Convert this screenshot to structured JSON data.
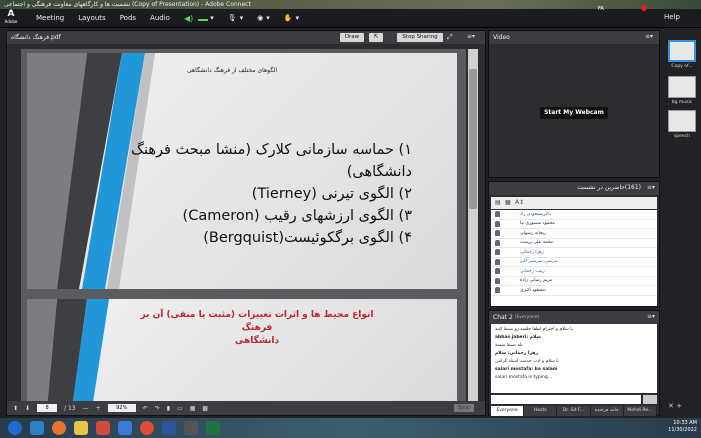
{
  "window": {
    "title": "نشست ها و کارگاههای معاونت فرهنگی و اجتماعی (Copy of Presentation) - Adobe Connect"
  },
  "menubar": {
    "logo": "Adobe",
    "items": [
      "Meeting",
      "Layouts",
      "Pods",
      "Audio"
    ],
    "help": "Help"
  },
  "share": {
    "filename": "فرهنگ دانشگاه.pdf",
    "draw_label": "Draw",
    "stop_label": "Stop Sharing",
    "page_current": "8",
    "page_total": "/ 13",
    "zoom": "92%",
    "sync_label": "Sync"
  },
  "slide1": {
    "title": "الگوهای مختلف از فرهنگ دانشگاهی",
    "bullets": [
      "۱) حماسه سازمانی کلارک (منشا مبحث فرهنگ دانشگاهی)",
      "۲) الگوی تیرنی (Tierney)",
      "۳) الگوی ارزشهای رقیب (Cameron)",
      "۴) الگوی برگکوئیست(Bergquist)"
    ]
  },
  "slide2": {
    "title_line1": "انواع محیط ها و اثرات تغییرات (مثبت یا منفی) آن بر فرهنگ",
    "title_line2": "دانشگاهی"
  },
  "video": {
    "title": "Video",
    "webcam_label": "Start My Webcam"
  },
  "attendees": {
    "title": "حاضرین در نشست",
    "count": "(161)",
    "names": [
      {
        "name": "دکترمسعودی زاد",
        "blue": true
      },
      {
        "name": "محمود منصوری نیا",
        "blue": false
      },
      {
        "name": "ریحانه رسولی",
        "blue": false
      },
      {
        "name": "محمد علی پرست",
        "blue": false
      },
      {
        "name": "زهرا رحمانی",
        "blue": true
      },
      {
        "name": "مرتضی سرشیر اکبر",
        "blue": true
      },
      {
        "name": "زینب رحمانی",
        "blue": true
      },
      {
        "name": "مریم رضایی زاده",
        "blue": false
      },
      {
        "name": "مسعود اکبری",
        "blue": false
      }
    ]
  },
  "chat": {
    "title": "Chat",
    "count": "2",
    "audience": "(Everyone)",
    "messages": [
      {
        "text": "با سلام و احترام لطفا جلسه رو ضبط کنید",
        "bold": false
      },
      {
        "text": "abbas jaberi: سلام",
        "bold": true
      },
      {
        "text": "بله ضبط میشه",
        "bold": false
      },
      {
        "text": "زهرا رحمانی: سلام",
        "bold": true
      },
      {
        "text": "با سلام و ادب خدمت استاد گرامی",
        "bold": false
      },
      {
        "text": "salari mostafa: ba salam",
        "bold": true
      },
      {
        "text": "salari mostafa is typing...",
        "bold": false
      }
    ],
    "tabs": [
      "Everyone",
      "Hosts",
      "Dr. Sit F...",
      "حامد فرخنده",
      "Mehdi Re..."
    ]
  },
  "layouts": {
    "items": [
      "Copy of...",
      "bg music",
      "speech"
    ]
  },
  "tray": {
    "lang": "FA",
    "time": "10:33 AM",
    "date": "11/30/2022"
  }
}
